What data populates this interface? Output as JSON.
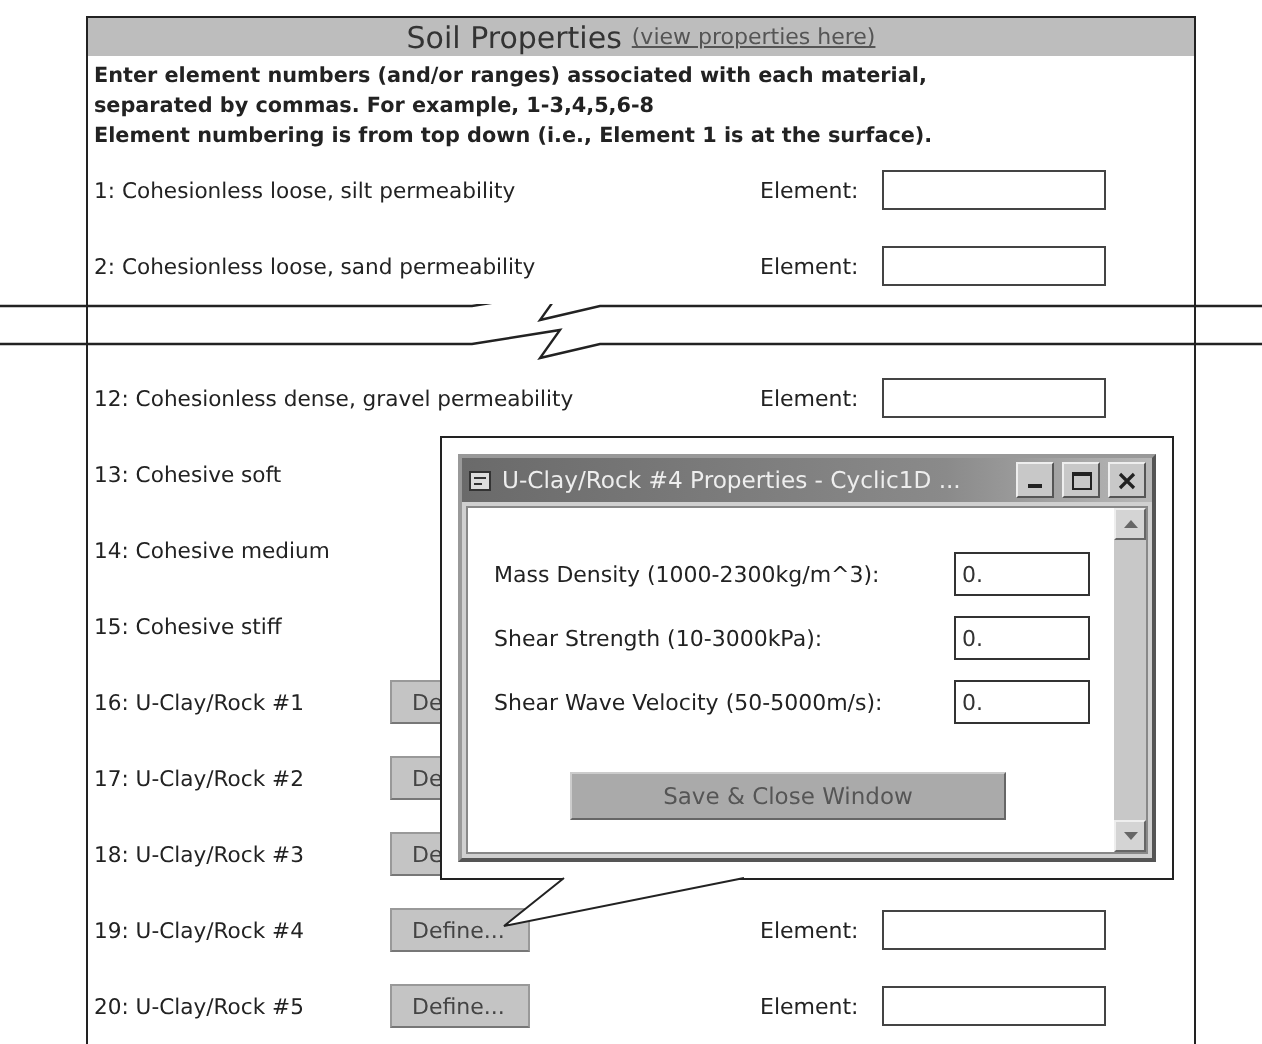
{
  "panel": {
    "title": "Soil Properties",
    "link": "(view properties here)",
    "intro": [
      "Enter element numbers (and/or ranges) associated with each material,",
      "separated by commas. For example, 1-3,4,5,6-8",
      "Element numbering is from top down (i.e., Element 1 is at the surface)."
    ]
  },
  "sections": [
    {
      "rows": [
        {
          "label": "1: Cohesionless loose, silt permeability",
          "element_label": "Element:"
        },
        {
          "label": "2: Cohesionless loose, sand permeability",
          "element_label": "Element:"
        }
      ]
    },
    {
      "rows": [
        {
          "label": "12: Cohesionless dense,  gravel permeability",
          "element_label": "Element:"
        },
        {
          "label": "13: Cohesive soft"
        },
        {
          "label": "14: Cohesive medium"
        },
        {
          "label": "15: Cohesive stiff"
        },
        {
          "label": "16: U-Clay/Rock #1",
          "button": "De"
        },
        {
          "label": "17: U-Clay/Rock #2",
          "button": "De"
        },
        {
          "label": "18: U-Clay/Rock #3",
          "button": "De"
        },
        {
          "label": "19: U-Clay/Rock #4",
          "button": "Define...",
          "element_label": "Element:"
        },
        {
          "label": "20: U-Clay/Rock #5",
          "button": "Define...",
          "element_label": "Element:"
        }
      ]
    }
  ],
  "popup": {
    "title": "U-Clay/Rock #4 Properties - Cyclic1D ...",
    "fields": [
      {
        "label": "Mass Density (1000-2300kg/m^3):",
        "value": "0."
      },
      {
        "label": "Shear Strength (10-3000kPa):",
        "value": "0."
      },
      {
        "label": "Shear Wave Velocity (50-5000m/s):",
        "value": "0."
      }
    ],
    "button": "Save & Close Window"
  }
}
